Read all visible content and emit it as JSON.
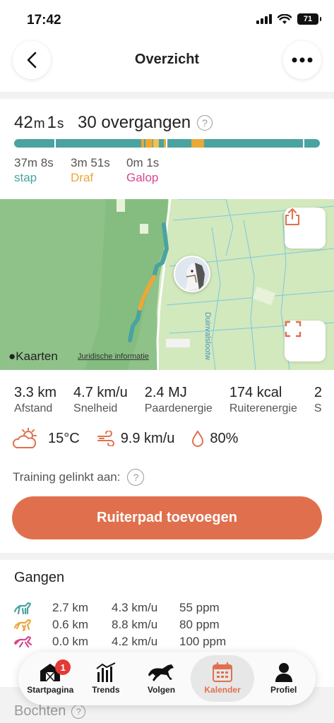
{
  "status_bar": {
    "time": "17:42",
    "battery": "71"
  },
  "header": {
    "title": "Overzicht"
  },
  "summary": {
    "duration_minutes": "42",
    "duration_minutes_unit": "m",
    "duration_seconds": "1",
    "duration_seconds_unit": "s",
    "transitions": "30 overgangen",
    "gaits": [
      {
        "time": "37m 8s",
        "name": "stap",
        "color": "#4aa3a0"
      },
      {
        "time": "3m 51s",
        "name": "Draf",
        "color": "#e9a838"
      },
      {
        "time": "0m 1s",
        "name": "Galop",
        "color": "#d6478f"
      }
    ]
  },
  "map": {
    "logo": "Kaarten",
    "legal": "Juridische informatie",
    "road_label": "Duinvalslootw"
  },
  "stats": [
    {
      "value": "3.3 km",
      "label": "Afstand"
    },
    {
      "value": "4.7 km/u",
      "label": "Snelheid"
    },
    {
      "value": "2.4 MJ",
      "label": "Paardenergie"
    },
    {
      "value": "174 kcal",
      "label": "Ruiterenergie"
    },
    {
      "value": "2",
      "label": "S"
    }
  ],
  "weather": {
    "temperature": "15°C",
    "wind": "9.9 km/u",
    "humidity": "80%"
  },
  "linked": {
    "label": "Training gelinkt aan:"
  },
  "cta": {
    "label": "Ruiterpad toevoegen"
  },
  "gangen": {
    "title": "Gangen",
    "rows": [
      {
        "gait": "stap",
        "distance": "2.7 km",
        "speed": "4.3 km/u",
        "tempo": "55 ppm",
        "color": "#4aa3a0"
      },
      {
        "gait": "draf",
        "distance": "0.6 km",
        "speed": "8.8 km/u",
        "tempo": "80 ppm",
        "color": "#e9a838"
      },
      {
        "gait": "galop",
        "distance": "0.0 km",
        "speed": "4.2 km/u",
        "tempo": "100 ppm",
        "color": "#d6478f"
      }
    ]
  },
  "bochten": {
    "title": "Bochten"
  },
  "tabbar": {
    "tabs": [
      {
        "label": "Startpagina",
        "badge": "1"
      },
      {
        "label": "Trends"
      },
      {
        "label": "Volgen"
      },
      {
        "label": "Kalender",
        "active": true
      },
      {
        "label": "Profiel"
      }
    ]
  },
  "colors": {
    "accent": "#e0704d",
    "stap": "#4aa3a0",
    "draf": "#e9a838",
    "galop": "#d6478f"
  }
}
